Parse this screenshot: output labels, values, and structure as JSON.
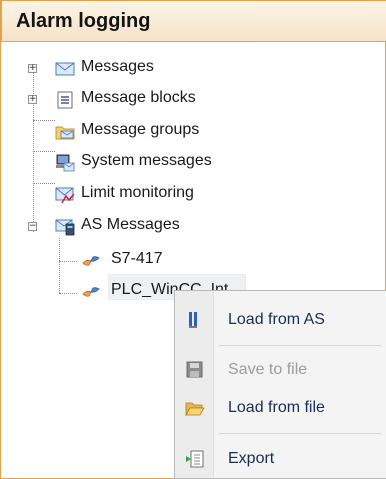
{
  "panel": {
    "title": "Alarm logging"
  },
  "tree": {
    "items": [
      {
        "label": "Messages",
        "icon": "envelope-icon",
        "expandable": true
      },
      {
        "label": "Message blocks",
        "icon": "document-list-icon",
        "expandable": true
      },
      {
        "label": "Message groups",
        "icon": "folder-envelope-icon",
        "expandable": false
      },
      {
        "label": "System messages",
        "icon": "computer-envelope-icon",
        "expandable": false
      },
      {
        "label": "Limit monitoring",
        "icon": "envelope-chart-icon",
        "expandable": false
      },
      {
        "label": "AS Messages",
        "icon": "plc-envelope-icon",
        "expandable": true,
        "expanded": true,
        "children": [
          {
            "label": "S7-417",
            "icon": "connection-icon"
          },
          {
            "label": "PLC_WinCC_Int",
            "icon": "connection-icon",
            "selected": true
          }
        ]
      }
    ]
  },
  "context_menu": {
    "items": [
      {
        "label": "Load from AS",
        "icon": "load-from-as-icon",
        "enabled": true
      },
      {
        "label": "Save to file",
        "icon": "floppy-disk-icon",
        "enabled": false
      },
      {
        "label": "Load from file",
        "icon": "open-folder-icon",
        "enabled": true
      },
      {
        "label": "Export",
        "icon": "export-icon",
        "enabled": true
      }
    ]
  },
  "colors": {
    "header_border": "#e3a24c",
    "menu_text": "#1c2c56",
    "disabled_text": "#9d9d9d"
  }
}
